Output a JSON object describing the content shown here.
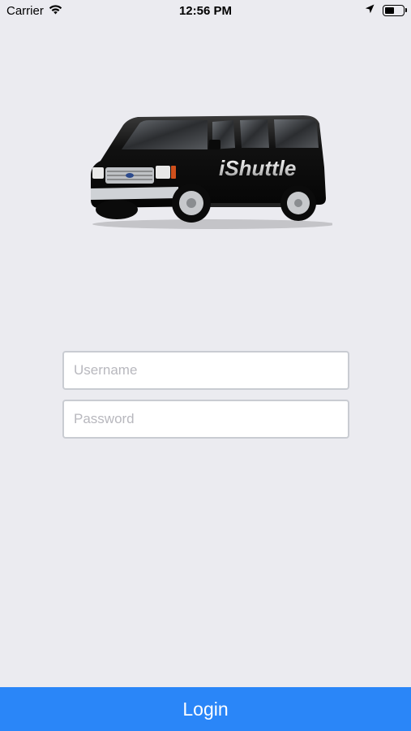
{
  "status_bar": {
    "carrier": "Carrier",
    "time": "12:56 PM",
    "battery_level": 0.55,
    "icons": [
      "wifi-icon",
      "location-arrow-icon",
      "battery-icon"
    ]
  },
  "logo": {
    "text": "iShuttle",
    "icon": "van-logo"
  },
  "form": {
    "username_placeholder": "Username",
    "password_placeholder": "Password",
    "username_value": "",
    "password_value": ""
  },
  "login_button": {
    "label": "Login"
  },
  "colors": {
    "background": "#ebebf0",
    "accent": "#2a86f8",
    "field_border": "#c9ccd2"
  }
}
